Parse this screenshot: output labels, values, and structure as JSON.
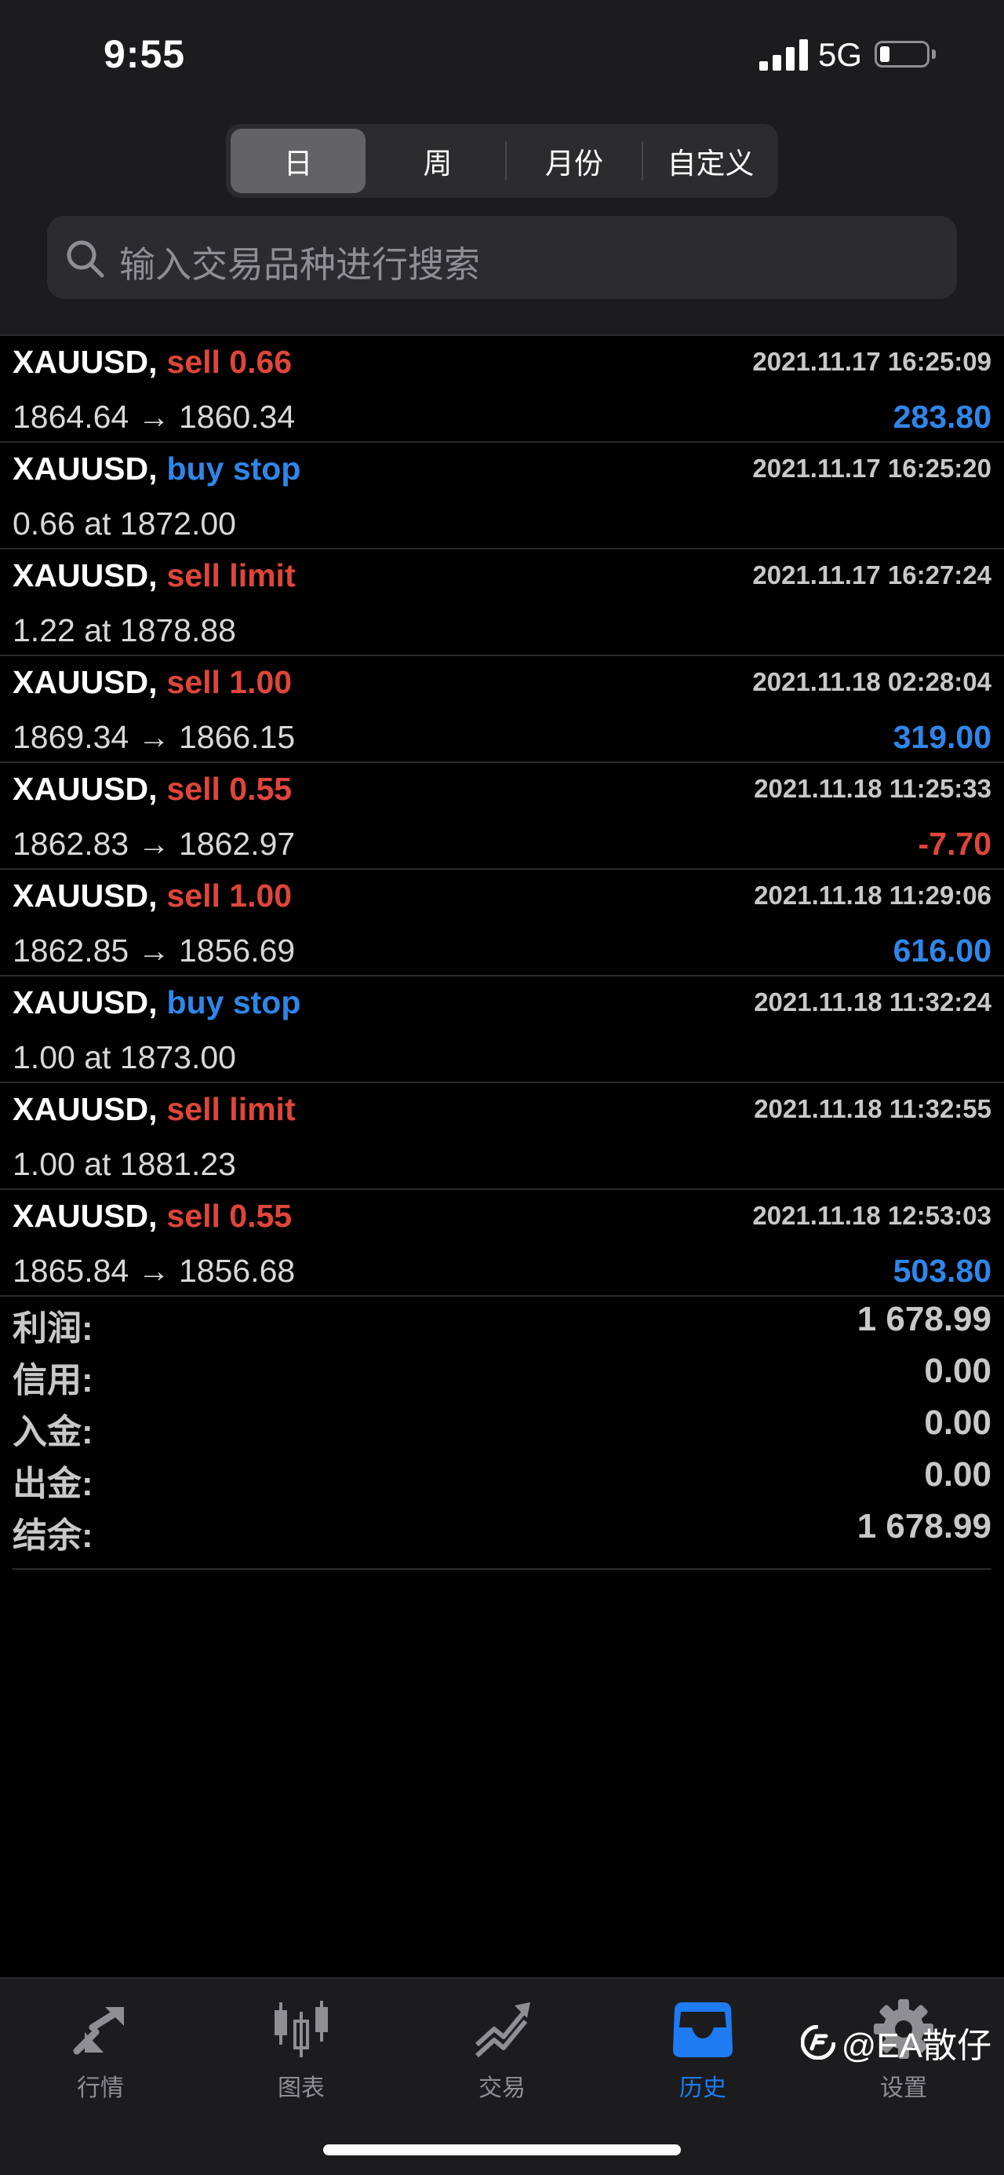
{
  "status": {
    "time": "9:55",
    "network": "5G"
  },
  "period_tabs": [
    {
      "label": "日",
      "active": true
    },
    {
      "label": "周",
      "active": false
    },
    {
      "label": "月份",
      "active": false
    },
    {
      "label": "自定义",
      "active": false
    }
  ],
  "search": {
    "placeholder": "输入交易品种进行搜索"
  },
  "deals": [
    {
      "symbol": "XAUUSD,",
      "action": "sell 0.66",
      "action_color": "red",
      "detail": "1864.64 → 1860.34",
      "time": "2021.11.17 16:25:09",
      "profit": "283.80",
      "profit_color": "blue"
    },
    {
      "symbol": "XAUUSD,",
      "action": "buy stop",
      "action_color": "blue",
      "detail": "0.66 at 1872.00",
      "time": "2021.11.17 16:25:20",
      "profit": "",
      "profit_color": "blue"
    },
    {
      "symbol": "XAUUSD,",
      "action": "sell limit",
      "action_color": "red",
      "detail": "1.22 at 1878.88",
      "time": "2021.11.17 16:27:24",
      "profit": "",
      "profit_color": "blue"
    },
    {
      "symbol": "XAUUSD,",
      "action": "sell 1.00",
      "action_color": "red",
      "detail": "1869.34 → 1866.15",
      "time": "2021.11.18 02:28:04",
      "profit": "319.00",
      "profit_color": "blue"
    },
    {
      "symbol": "XAUUSD,",
      "action": "sell 0.55",
      "action_color": "red",
      "detail": "1862.83 → 1862.97",
      "time": "2021.11.18 11:25:33",
      "profit": "-7.70",
      "profit_color": "red"
    },
    {
      "symbol": "XAUUSD,",
      "action": "sell 1.00",
      "action_color": "red",
      "detail": "1862.85 → 1856.69",
      "time": "2021.11.18 11:29:06",
      "profit": "616.00",
      "profit_color": "blue"
    },
    {
      "symbol": "XAUUSD,",
      "action": "buy stop",
      "action_color": "blue",
      "detail": "1.00 at 1873.00",
      "time": "2021.11.18 11:32:24",
      "profit": "",
      "profit_color": "blue"
    },
    {
      "symbol": "XAUUSD,",
      "action": "sell limit",
      "action_color": "red",
      "detail": "1.00 at 1881.23",
      "time": "2021.11.18 11:32:55",
      "profit": "",
      "profit_color": "blue"
    },
    {
      "symbol": "XAUUSD,",
      "action": "sell 0.55",
      "action_color": "red",
      "detail": "1865.84 → 1856.68",
      "time": "2021.11.18 12:53:03",
      "profit": "503.80",
      "profit_color": "blue"
    }
  ],
  "summary": [
    {
      "label": "利润:",
      "value": "1 678.99"
    },
    {
      "label": "信用:",
      "value": "0.00"
    },
    {
      "label": "入金:",
      "value": "0.00"
    },
    {
      "label": "出金:",
      "value": "0.00"
    },
    {
      "label": "结余:",
      "value": "1 678.99"
    }
  ],
  "tabbar": [
    {
      "label": "行情",
      "icon": "quotes-icon",
      "active": false
    },
    {
      "label": "图表",
      "icon": "chart-candles-icon",
      "active": false
    },
    {
      "label": "交易",
      "icon": "trade-icon",
      "active": false
    },
    {
      "label": "历史",
      "icon": "history-inbox-icon",
      "active": true
    },
    {
      "label": "设置",
      "icon": "gear-icon",
      "active": false
    }
  ],
  "watermark": "@EA散仔",
  "colors": {
    "red": "#e0453a",
    "blue": "#2f86ea",
    "active_tab": "#1e7bf2"
  }
}
